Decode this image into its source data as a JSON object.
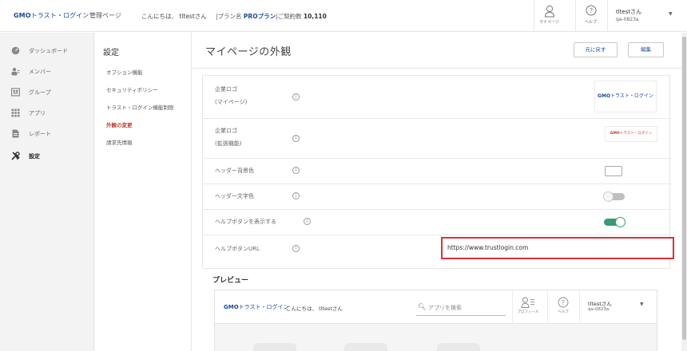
{
  "header": {
    "logo_gmo": "GMO",
    "logo_rest": "トラスト・ログイン",
    "admin_page": "管理ページ",
    "greeting": "こんにちは、 tltestさん",
    "plan_prefix": "|プラン名",
    "plan_name": "PROプラン",
    "contract_prefix": "|ご契約数",
    "contract_count": "10,110",
    "mypage_label": "マイページ",
    "help_label": "ヘルプ",
    "user_name": "tltestさん",
    "user_id": "qa-0823a"
  },
  "sidebar": {
    "items": [
      {
        "label": "ダッシュボード",
        "icon": "dashboard-icon"
      },
      {
        "label": "メンバー",
        "icon": "members-icon"
      },
      {
        "label": "グループ",
        "icon": "group-icon"
      },
      {
        "label": "アプリ",
        "icon": "apps-icon"
      },
      {
        "label": "レポート",
        "icon": "report-icon"
      },
      {
        "label": "設定",
        "icon": "settings-icon"
      }
    ]
  },
  "subnav": {
    "title": "設定",
    "items": [
      "オプション機能",
      "セキュリティポリシー",
      "トラスト・ログイン機能制限",
      "外観の変更",
      "請求先情報"
    ]
  },
  "main": {
    "title": "マイページの外観",
    "reset_button": "元に戻す",
    "edit_button": "編集",
    "rows": {
      "logo_mypage_label1": "企業ロゴ",
      "logo_mypage_label2": "(マイページ)",
      "logo_ext_label1": "企業ロゴ",
      "logo_ext_label2": "(拡張機能)",
      "header_bg_label": "ヘッダー背景色",
      "header_text_label": "ヘッダー文字色",
      "help_show_label": "ヘルプボタンを表示する",
      "help_url_label": "ヘルプボタンURL",
      "help_url_value": "https://www.trustlogin.com"
    },
    "header_bg_color": "#ffffff",
    "header_text_toggle": false,
    "help_show_toggle": true,
    "accent_green": "#3a9a72",
    "highlight_red": "#d8323a",
    "brand_blue": "#1a4a9c"
  },
  "preview": {
    "title": "プレビュー",
    "greeting": "こんにちは、 tltestさん",
    "search_placeholder": "アプリを検索",
    "profile_label": "プロフィール",
    "help_label": "ヘルプ",
    "user_name": "tltestさん",
    "user_id": "qa-0823a"
  }
}
